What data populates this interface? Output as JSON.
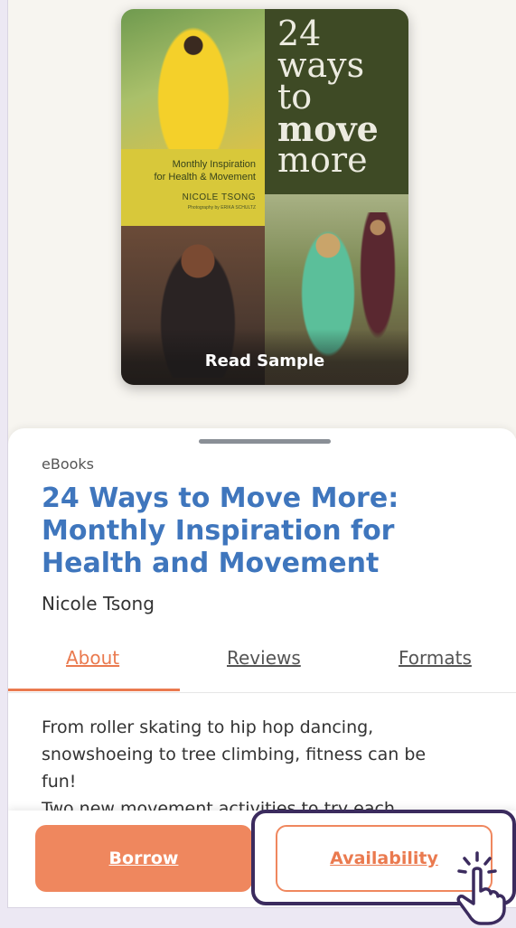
{
  "cover": {
    "title_line1": "24",
    "title_line2": "ways",
    "title_line3": "to",
    "title_line4": "move",
    "title_line5": "more",
    "subtitle_line1": "Monthly Inspiration",
    "subtitle_line2": "for Health & Movement",
    "author": "NICOLE TSONG",
    "photo_credit": "Photography by ERIKA SCHULTZ",
    "read_sample": "Read Sample"
  },
  "details": {
    "category": "eBooks",
    "title_line1": "24 Ways to Move More:",
    "title_line2": "Monthly Inspiration for",
    "title_line3": "Health and Movement",
    "author": "Nicole Tsong"
  },
  "tabs": [
    {
      "label": "About"
    },
    {
      "label": "Reviews"
    },
    {
      "label": "Formats"
    }
  ],
  "description": {
    "line1": "From roller skating to hip hop dancing,",
    "line2": "snowshoeing to tree climbing, fitness can be",
    "line3": "fun!",
    "line4": "Two new movement activities to try each"
  },
  "actions": {
    "borrow_label": "Borrow",
    "availability_label": "Availability"
  },
  "colors": {
    "accent": "#ef875e",
    "title_blue": "#3f76bd",
    "highlight": "#3b2b5e"
  }
}
